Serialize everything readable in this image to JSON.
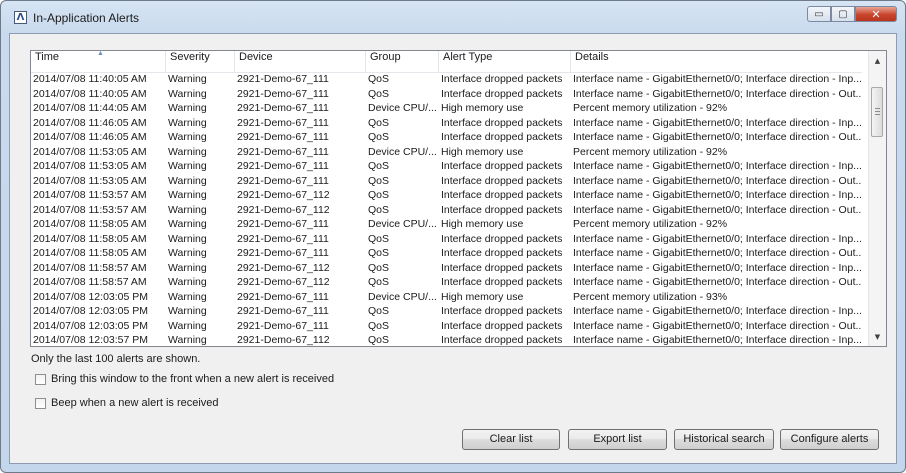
{
  "window": {
    "title": "In-Application Alerts",
    "app_icon_glyph": "Λ",
    "controls": {
      "minimize_glyph": "▭",
      "maximize_glyph": "▢",
      "close_glyph": "✕"
    }
  },
  "table": {
    "columns": [
      "Time",
      "Severity",
      "Device",
      "Group",
      "Alert Type",
      "Details"
    ],
    "sort_indicator": "▲",
    "rows": [
      [
        "2014/07/08 11:40:05 AM",
        "Warning",
        "2921-Demo-67_111",
        "QoS",
        "Interface dropped packets",
        "Interface name - GigabitEthernet0/0;  Interface direction - Inp..."
      ],
      [
        "2014/07/08 11:40:05 AM",
        "Warning",
        "2921-Demo-67_111",
        "QoS",
        "Interface dropped packets",
        "Interface name - GigabitEthernet0/0;  Interface direction - Out..."
      ],
      [
        "2014/07/08 11:44:05 AM",
        "Warning",
        "2921-Demo-67_111",
        "Device CPU/...",
        "High memory use",
        "Percent memory utilization - 92%"
      ],
      [
        "2014/07/08 11:46:05 AM",
        "Warning",
        "2921-Demo-67_111",
        "QoS",
        "Interface dropped packets",
        "Interface name - GigabitEthernet0/0;  Interface direction - Inp..."
      ],
      [
        "2014/07/08 11:46:05 AM",
        "Warning",
        "2921-Demo-67_111",
        "QoS",
        "Interface dropped packets",
        "Interface name - GigabitEthernet0/0;  Interface direction - Out..."
      ],
      [
        "2014/07/08 11:53:05 AM",
        "Warning",
        "2921-Demo-67_111",
        "Device CPU/...",
        "High memory use",
        "Percent memory utilization - 92%"
      ],
      [
        "2014/07/08 11:53:05 AM",
        "Warning",
        "2921-Demo-67_111",
        "QoS",
        "Interface dropped packets",
        "Interface name - GigabitEthernet0/0;  Interface direction - Inp..."
      ],
      [
        "2014/07/08 11:53:05 AM",
        "Warning",
        "2921-Demo-67_111",
        "QoS",
        "Interface dropped packets",
        "Interface name - GigabitEthernet0/0;  Interface direction - Out..."
      ],
      [
        "2014/07/08 11:53:57 AM",
        "Warning",
        "2921-Demo-67_112",
        "QoS",
        "Interface dropped packets",
        "Interface name - GigabitEthernet0/0;  Interface direction - Inp..."
      ],
      [
        "2014/07/08 11:53:57 AM",
        "Warning",
        "2921-Demo-67_112",
        "QoS",
        "Interface dropped packets",
        "Interface name - GigabitEthernet0/0;  Interface direction - Out..."
      ],
      [
        "2014/07/08 11:58:05 AM",
        "Warning",
        "2921-Demo-67_111",
        "Device CPU/...",
        "High memory use",
        "Percent memory utilization - 92%"
      ],
      [
        "2014/07/08 11:58:05 AM",
        "Warning",
        "2921-Demo-67_111",
        "QoS",
        "Interface dropped packets",
        "Interface name - GigabitEthernet0/0;  Interface direction - Inp..."
      ],
      [
        "2014/07/08 11:58:05 AM",
        "Warning",
        "2921-Demo-67_111",
        "QoS",
        "Interface dropped packets",
        "Interface name - GigabitEthernet0/0;  Interface direction - Out..."
      ],
      [
        "2014/07/08 11:58:57 AM",
        "Warning",
        "2921-Demo-67_112",
        "QoS",
        "Interface dropped packets",
        "Interface name - GigabitEthernet0/0;  Interface direction - Inp..."
      ],
      [
        "2014/07/08 11:58:57 AM",
        "Warning",
        "2921-Demo-67_112",
        "QoS",
        "Interface dropped packets",
        "Interface name - GigabitEthernet0/0;  Interface direction - Out..."
      ],
      [
        "2014/07/08 12:03:05 PM",
        "Warning",
        "2921-Demo-67_111",
        "Device CPU/...",
        "High memory use",
        "Percent memory utilization - 93%"
      ],
      [
        "2014/07/08 12:03:05 PM",
        "Warning",
        "2921-Demo-67_111",
        "QoS",
        "Interface dropped packets",
        "Interface name - GigabitEthernet0/0;  Interface direction - Inp..."
      ],
      [
        "2014/07/08 12:03:05 PM",
        "Warning",
        "2921-Demo-67_111",
        "QoS",
        "Interface dropped packets",
        "Interface name - GigabitEthernet0/0;  Interface direction - Out..."
      ],
      [
        "2014/07/08 12:03:57 PM",
        "Warning",
        "2921-Demo-67_112",
        "QoS",
        "Interface dropped packets",
        "Interface name - GigabitEthernet0/0;  Interface direction - Inp..."
      ]
    ],
    "scrollbar": {
      "up_glyph": "▲",
      "down_glyph": "▼"
    }
  },
  "note": "Only the last 100 alerts are shown.",
  "options": {
    "bring_to_front_label": "Bring this window to the front when a new alert is received",
    "bring_to_front_checked": false,
    "beep_label": "Beep when a new alert is received",
    "beep_checked": false
  },
  "buttons": {
    "clear_list": "Clear list",
    "export_list": "Export list",
    "historical_search": "Historical search",
    "configure_alerts": "Configure alerts"
  }
}
